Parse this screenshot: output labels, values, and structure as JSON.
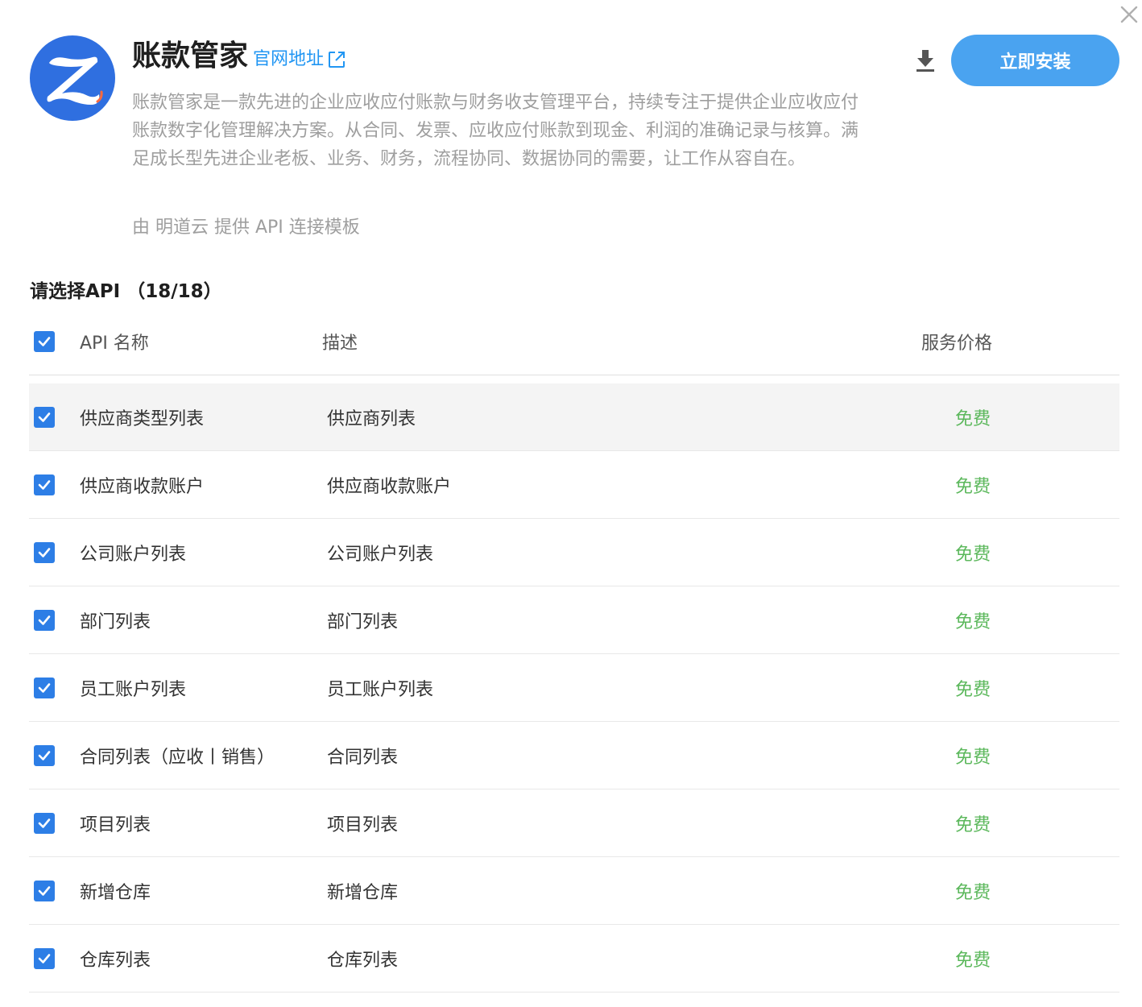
{
  "header": {
    "app_name": "账款管家",
    "official_link_label": "官网地址",
    "description": "账款管家是一款先进的企业应收应付账款与财务收支管理平台，持续专注于提供企业应收应付账款数字化管理解决方案。从合同、发票、应收应付账款到现金、利润的准确记录与核算。满足成长型先进企业老板、业务、财务，流程协同、数据协同的需要，让工作从容自在。",
    "provider_text": "由 明道云 提供 API 连接模板",
    "install_label": "立即安装",
    "brand_color": "#4aa3f0",
    "logo_color": "#2f6fe0"
  },
  "api_section": {
    "title": "请选择API （18/18）",
    "columns": {
      "name": "API 名称",
      "description": "描述",
      "price": "服务价格"
    },
    "rows": [
      {
        "name": "供应商类型列表",
        "description": "供应商列表",
        "price": "免费",
        "checked": true
      },
      {
        "name": "供应商收款账户",
        "description": "供应商收款账户",
        "price": "免费",
        "checked": true
      },
      {
        "name": "公司账户列表",
        "description": "公司账户列表",
        "price": "免费",
        "checked": true
      },
      {
        "name": "部门列表",
        "description": "部门列表",
        "price": "免费",
        "checked": true
      },
      {
        "name": "员工账户列表",
        "description": "员工账户列表",
        "price": "免费",
        "checked": true
      },
      {
        "name": "合同列表（应收丨销售）",
        "description": "合同列表",
        "price": "免费",
        "checked": true
      },
      {
        "name": "项目列表",
        "description": "项目列表",
        "price": "免费",
        "checked": true
      },
      {
        "name": "新增仓库",
        "description": "新增仓库",
        "price": "免费",
        "checked": true
      },
      {
        "name": "仓库列表",
        "description": "仓库列表",
        "price": "免费",
        "checked": true
      }
    ]
  },
  "colors": {
    "checkbox": "#2d7ee6",
    "price_free": "#5cb85c",
    "link": "#2196f3"
  }
}
